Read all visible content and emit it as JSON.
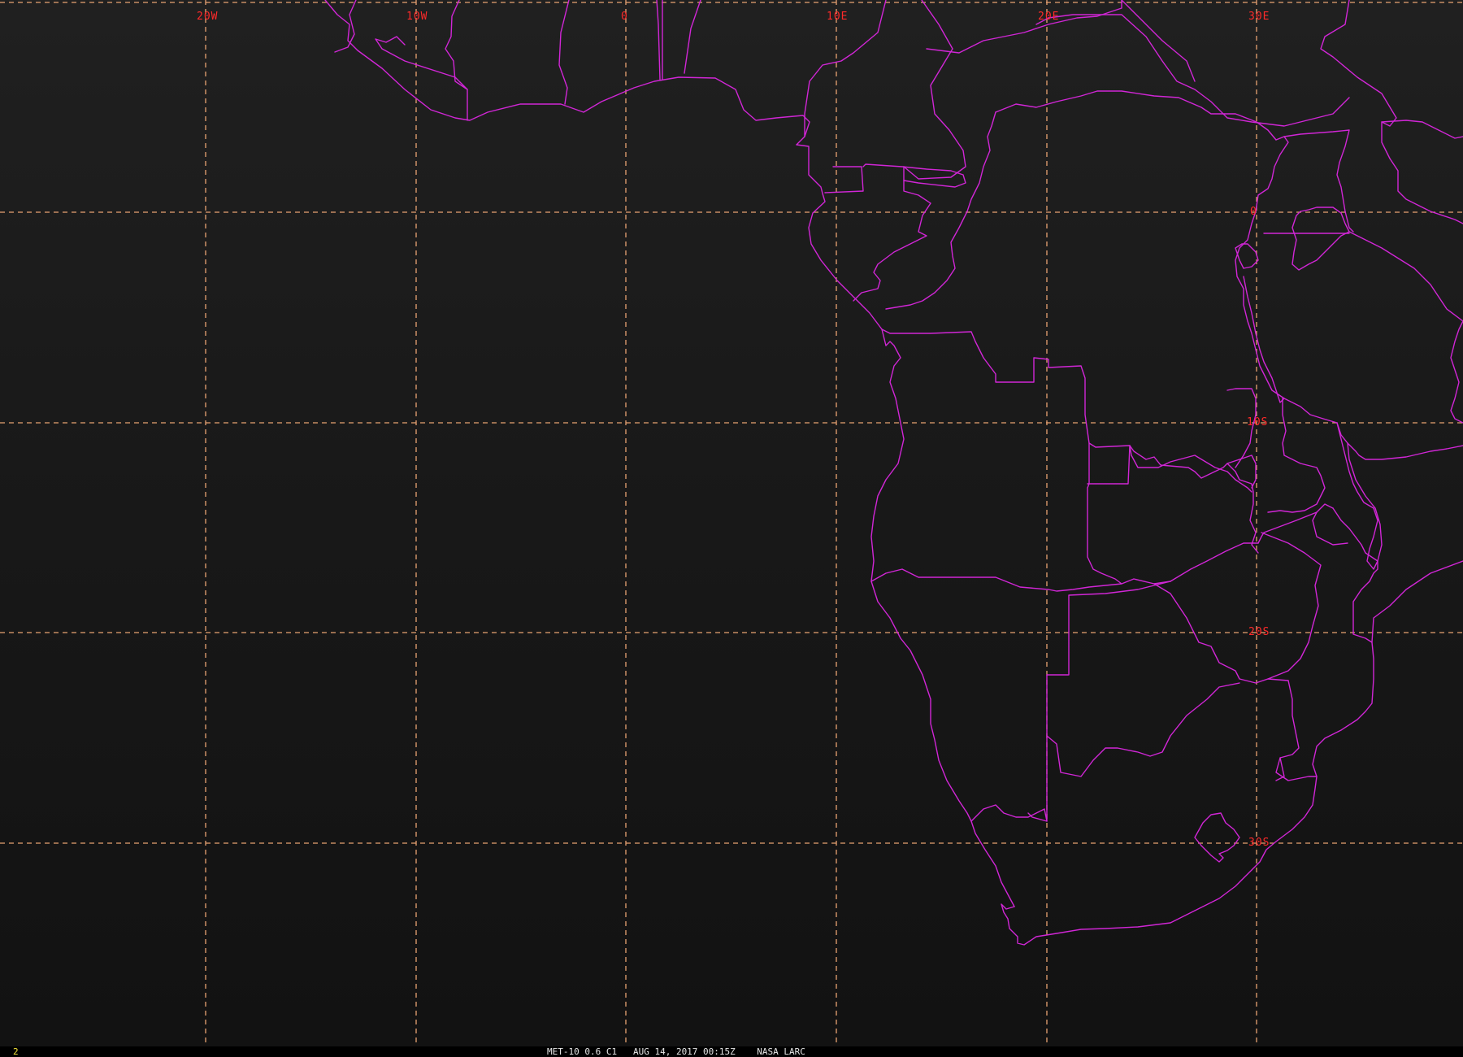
{
  "map": {
    "projection": "geostationary satellite view",
    "region": "Southern Africa and South Atlantic",
    "longitude_labels": [
      "20W",
      "10W",
      "0",
      "10E",
      "20E",
      "30E"
    ],
    "latitude_labels": [
      "0",
      "10S",
      "20S",
      "30S"
    ],
    "colors": {
      "background": "#151515",
      "graticule": "#e8a272",
      "borders": "#d126d6",
      "grid_labels": "#ff2a2a"
    }
  },
  "status_bar": {
    "frame_number": "2",
    "caption": "MET-10 0.6 C1   AUG 14, 2017 00:15Z    NASA LARC"
  }
}
